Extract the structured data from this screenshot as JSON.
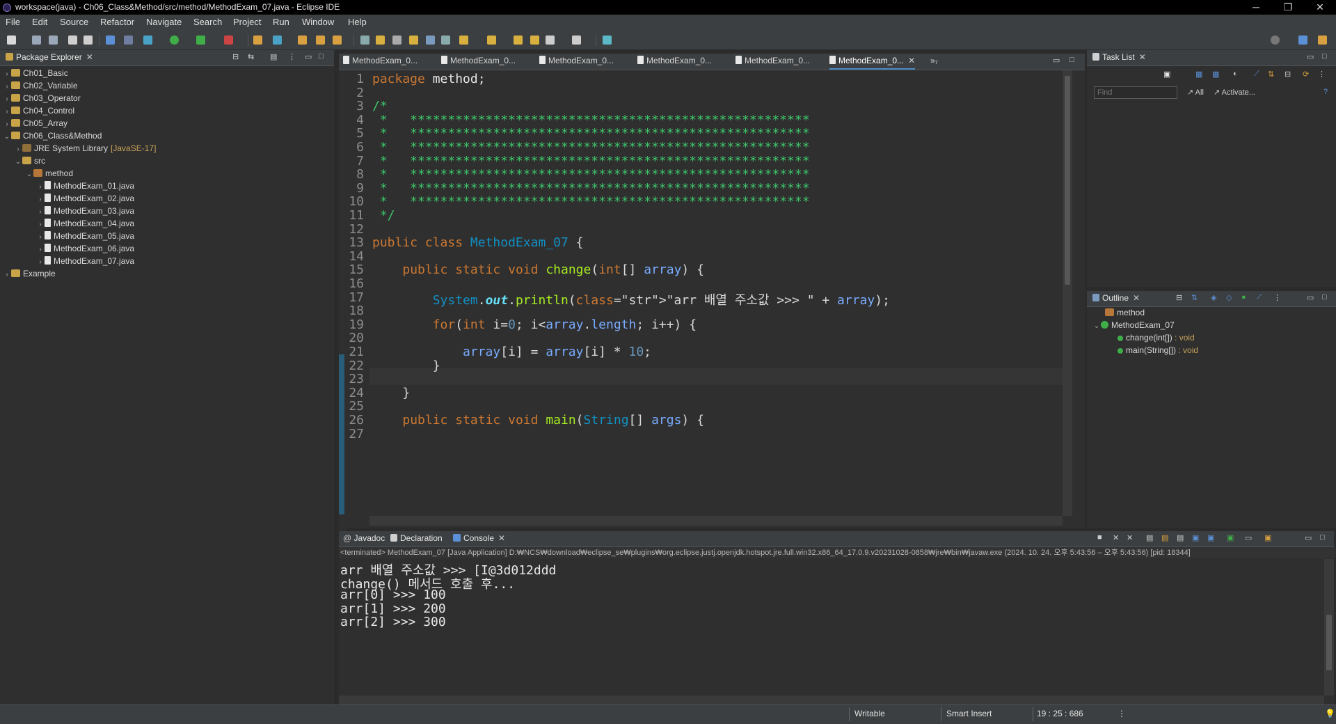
{
  "window": {
    "title": "workspace(java) - Ch06_Class&Method/src/method/MethodExam_07.java - Eclipse IDE",
    "minimize": "─",
    "restore": "❐",
    "close": "✕"
  },
  "menu": [
    "File",
    "Edit",
    "Source",
    "Refactor",
    "Navigate",
    "Search",
    "Project",
    "Run",
    "Window",
    "Help"
  ],
  "package_explorer": {
    "title": "Package Explorer",
    "tree": [
      {
        "label": "Ch01_Basic",
        "icon": "project",
        "expanded": false,
        "depth": 0
      },
      {
        "label": "Ch02_Variable",
        "icon": "project",
        "expanded": false,
        "depth": 0
      },
      {
        "label": "Ch03_Operator",
        "icon": "project",
        "expanded": false,
        "depth": 0
      },
      {
        "label": "Ch04_Control",
        "icon": "project",
        "expanded": false,
        "depth": 0
      },
      {
        "label": "Ch05_Array",
        "icon": "project",
        "expanded": false,
        "depth": 0
      },
      {
        "label": "Ch06_Class&Method",
        "icon": "project",
        "expanded": true,
        "depth": 0
      },
      {
        "label": "JRE System Library",
        "suffix": "[JavaSE-17]",
        "icon": "library",
        "expanded": false,
        "depth": 1
      },
      {
        "label": "src",
        "icon": "source-folder",
        "expanded": true,
        "depth": 1
      },
      {
        "label": "method",
        "icon": "package",
        "expanded": true,
        "depth": 2
      },
      {
        "label": "MethodExam_01.java",
        "icon": "java-file",
        "expanded": false,
        "depth": 3
      },
      {
        "label": "MethodExam_02.java",
        "icon": "java-file",
        "expanded": false,
        "depth": 3
      },
      {
        "label": "MethodExam_03.java",
        "icon": "java-file",
        "expanded": false,
        "depth": 3
      },
      {
        "label": "MethodExam_04.java",
        "icon": "java-file",
        "expanded": false,
        "depth": 3
      },
      {
        "label": "MethodExam_05.java",
        "icon": "java-file",
        "expanded": false,
        "depth": 3
      },
      {
        "label": "MethodExam_06.java",
        "icon": "java-file",
        "expanded": false,
        "depth": 3
      },
      {
        "label": "MethodExam_07.java",
        "icon": "java-file",
        "expanded": false,
        "depth": 3
      },
      {
        "label": "Example",
        "icon": "project",
        "expanded": false,
        "depth": 0
      }
    ]
  },
  "editor": {
    "tabs": [
      "MethodExam_0...",
      "MethodExam_0...",
      "MethodExam_0...",
      "MethodExam_0...",
      "MethodExam_0...",
      "MethodExam_0..."
    ],
    "active_tab": 5,
    "overflow": "»₇",
    "lines": [
      "package method;",
      "",
      "/*",
      " *   *****************************************************",
      " *   *****************************************************",
      " *   *****************************************************",
      " *   *****************************************************",
      " *   *****************************************************",
      " *   *****************************************************",
      " *   *****************************************************",
      " */",
      "",
      "public class MethodExam_07 {",
      "",
      "    public static void change(int[] array) {",
      "",
      "        System.out.println(\"arr 배열 주소값 >>> \" + array);",
      "",
      "        for(int i=0; i<array.length; i++) {",
      "",
      "            array[i] = array[i] * 10;",
      "        }",
      "",
      "    }",
      "",
      "    public static void main(String[] args) {",
      ""
    ],
    "cursor_line": 19
  },
  "task_list": {
    "title": "Task List",
    "find_placeholder": "Find",
    "all_label": "All",
    "activate_label": "Activate..."
  },
  "outline": {
    "title": "Outline",
    "items": [
      {
        "label": "method",
        "suffix": "",
        "depth": 0
      },
      {
        "label": "MethodExam_07",
        "suffix": "",
        "depth": 0
      },
      {
        "label": "change(int[])",
        "suffix": " : void",
        "depth": 1
      },
      {
        "label": "main(String[])",
        "suffix": " : void",
        "depth": 1
      }
    ]
  },
  "bottom_tabs": [
    "Javadoc",
    "Declaration",
    "Console"
  ],
  "console": {
    "header": "<terminated> MethodExam_07 [Java Application] D:₩NCS₩download₩eclipse_se₩plugins₩org.eclipse.justj.openjdk.hotspot.jre.full.win32.x86_64_17.0.9.v20231028-0858₩jre₩bin₩javaw.exe  (2024. 10. 24. 오후 5:43:56 – 오후 5:43:56) [pid: 18344]",
    "output": [
      "arr 배열 주소값 >>> [I@3d012ddd",
      "change() 메서드 호출 후...",
      "arr[0] >>> 100",
      "arr[1] >>> 200",
      "arr[2] >>> 300"
    ]
  },
  "status": {
    "writable": "Writable",
    "insert_mode": "Smart Insert",
    "position": "19 : 25 : 686"
  },
  "colors": {
    "keyword": "#cc7832",
    "class": "#1290c3",
    "method": "#a7ec21",
    "string": "#17c6a3",
    "number": "#6897bb",
    "comment": "#3ec66a",
    "variable": "#79abff",
    "accent": "#4a88c7"
  }
}
